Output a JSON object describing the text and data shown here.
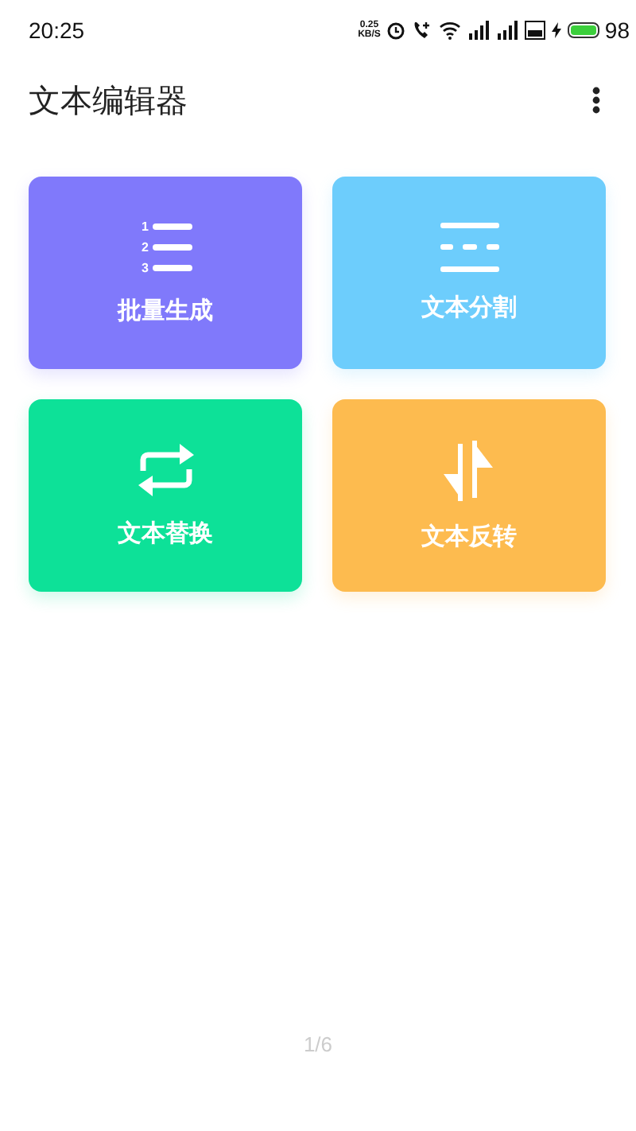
{
  "status_bar": {
    "time": "20:25",
    "net_speed": "0.25",
    "net_unit": "KB/S",
    "battery": "98"
  },
  "app_bar": {
    "title": "文本编辑器"
  },
  "tools": [
    {
      "label": "批量生成",
      "kind": "numbered-list",
      "color": "#8079fb",
      "icon_labels": [
        "1",
        "2",
        "3"
      ]
    },
    {
      "label": "文本分割",
      "kind": "split",
      "color": "#6dcdfc"
    },
    {
      "label": "文本替换",
      "kind": "swap",
      "color": "#0de198"
    },
    {
      "label": "文本反转",
      "kind": "reverse",
      "color": "#fdbb4f"
    }
  ],
  "pager": "1/6"
}
